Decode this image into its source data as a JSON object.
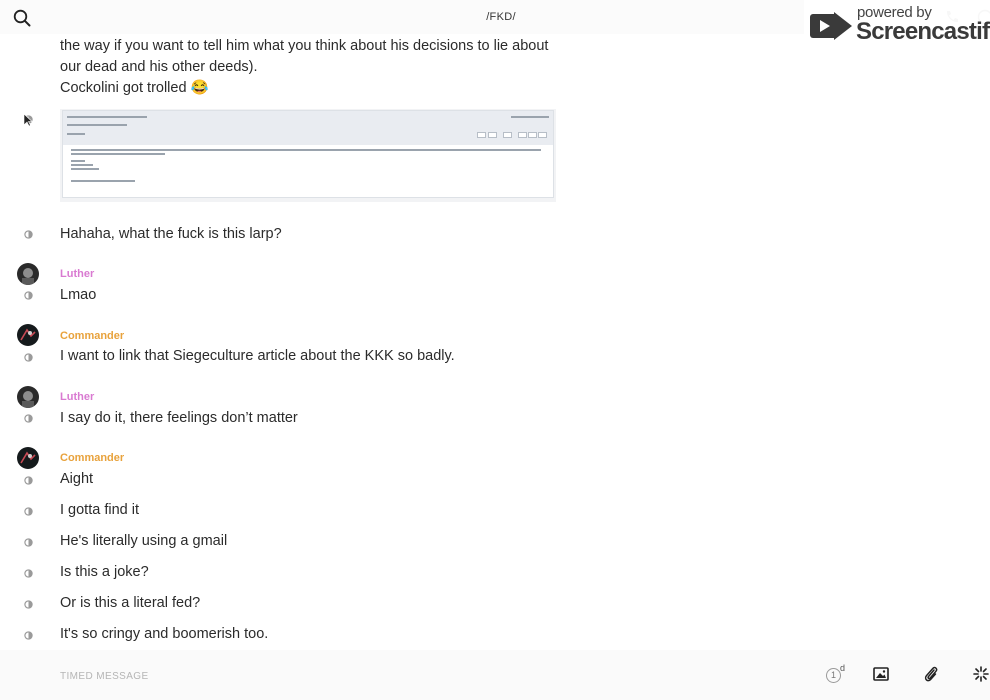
{
  "header": {
    "title": "/FKD/",
    "search_icon": "search-icon",
    "call_icon": "phone-icon",
    "info_icon": "info-icon"
  },
  "watermark": {
    "powered_by": "powered by",
    "brand": "Screencastify"
  },
  "messages": [
    {
      "kind": "text",
      "text": "the way if you want to tell him what you think about his decisions to lie about"
    },
    {
      "kind": "text",
      "text": "our dead and his other deeds)."
    },
    {
      "kind": "text",
      "text": "Cockolini got trolled 😂"
    },
    {
      "kind": "image",
      "description_icon": "email-screenshot-attachment"
    },
    {
      "kind": "text",
      "text": "Hahaha, what the fuck is this larp?"
    },
    {
      "kind": "sender",
      "name": "Luther"
    },
    {
      "kind": "text",
      "text": "Lmao"
    },
    {
      "kind": "sender",
      "name": "Commander"
    },
    {
      "kind": "text",
      "text": "I want to link that Siegeculture article about the KKK so badly."
    },
    {
      "kind": "sender",
      "name": "Luther"
    },
    {
      "kind": "text",
      "text": "I say do it, there feelings don’t matter"
    },
    {
      "kind": "sender",
      "name": "Commander"
    },
    {
      "kind": "text",
      "text": "Aight"
    },
    {
      "kind": "text",
      "text": "I gotta find it"
    },
    {
      "kind": "text",
      "text": "He's literally using a gmail"
    },
    {
      "kind": "text",
      "text": "Is this a joke?"
    },
    {
      "kind": "text",
      "text": "Or is this a literal fed?"
    },
    {
      "kind": "text",
      "text": "It's so cringy and boomerish too."
    }
  ],
  "composer": {
    "placeholder": "TIMED MESSAGE",
    "timer_value": "1",
    "timer_unit": "d"
  },
  "colors": {
    "luther": "#d97ad1",
    "commander": "#e8a23c",
    "text": "#2b2b2b"
  }
}
